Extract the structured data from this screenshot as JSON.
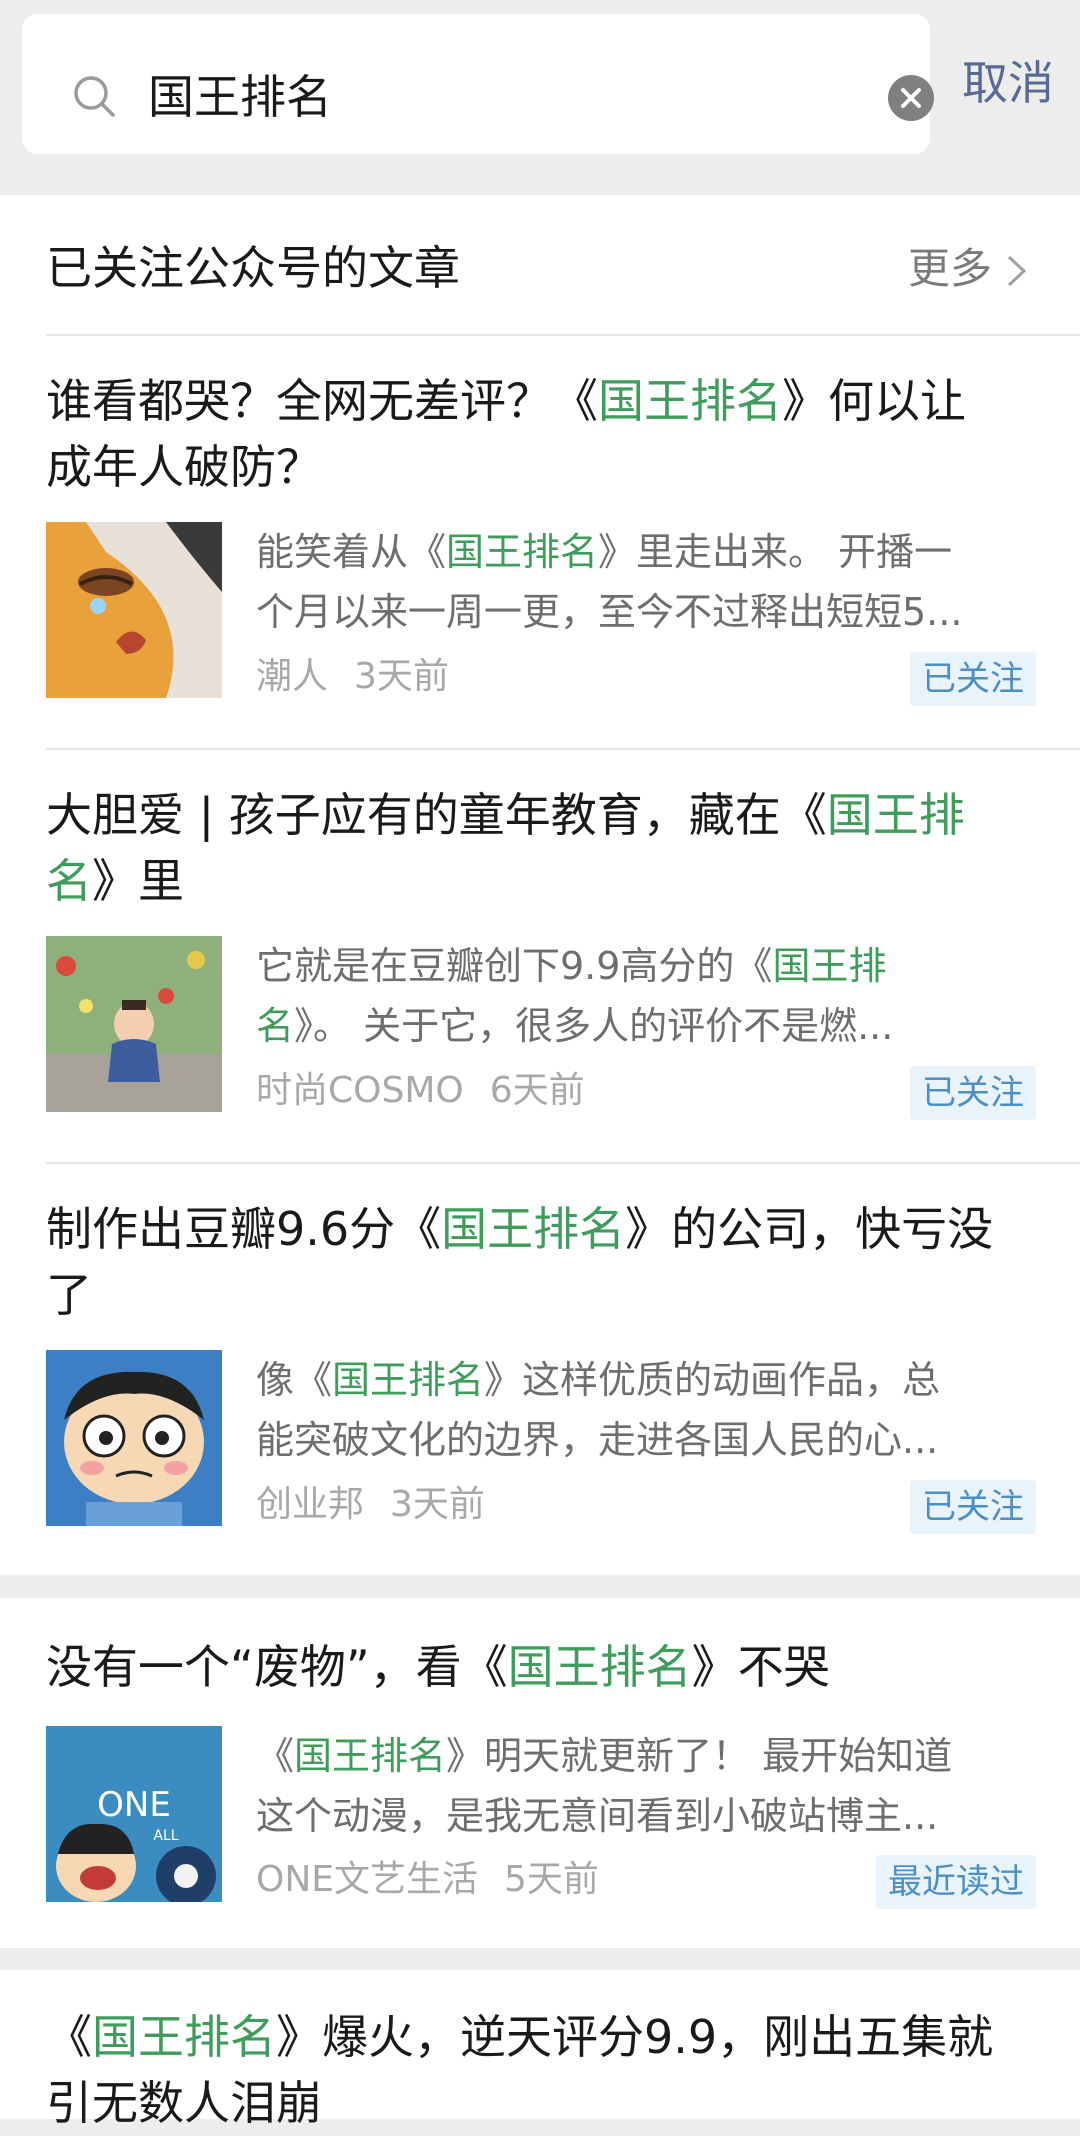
{
  "search": {
    "query": "国王排名",
    "cancel_label": "取消"
  },
  "section": {
    "title": "已关注公众号的文章",
    "more_label": "更多"
  },
  "articles": [
    {
      "title_parts": [
        "谁看都哭？全网无差评？《",
        "国王排名",
        "》何以让\n成年人破防？"
      ],
      "summary_parts": [
        "能笑着从《",
        "国王排名",
        "》里走出来。 开播一\n个月以来一周一更，至今不过释出短短5..."
      ],
      "source": "潮人",
      "time": "3天前",
      "badge": "已关注"
    },
    {
      "title_parts": [
        "大胆爱 | 孩子应有的童年教育，藏在《",
        "国王排\n名",
        "》里"
      ],
      "summary_parts": [
        "它就是在豆瓣创下9.9高分的《",
        "国王排\n名",
        "》。 关于它，很多人的评价不是燃..."
      ],
      "source": "时尚COSMO",
      "time": "6天前",
      "badge": "已关注"
    },
    {
      "title_parts": [
        "制作出豆瓣9.6分《",
        "国王排名",
        "》的公司，快亏没\n了"
      ],
      "summary_parts": [
        "像《",
        "国王排名",
        "》这样优质的动画作品，总\n能突破文化的边界，走进各国人民的心..."
      ],
      "source": "创业邦",
      "time": "3天前",
      "badge": "已关注"
    },
    {
      "title_parts": [
        "没有一个“废物”，看《",
        "国王排名",
        "》不哭"
      ],
      "summary_parts": [
        "《",
        "国王排名",
        "》明天就更新了！ 最开始知道\n这个动漫，是我无意间看到小破站博主..."
      ],
      "source": "ONE文艺生活",
      "time": "5天前",
      "badge": "最近读过",
      "thumb_text": "ONE",
      "thumb_subtext": "ALL"
    },
    {
      "title_parts": [
        "《",
        "国王排名",
        "》爆火，逆天评分9.9，刚出五集就\n引无数人泪崩"
      ]
    }
  ],
  "colors": {
    "highlight": "#3f9d5b",
    "link": "#576b95",
    "badge_text": "#4b8fc8",
    "badge_bg": "#e8f3fb",
    "page_bg": "#ededed"
  },
  "icons": {
    "search": "search-icon",
    "clear": "clear-icon",
    "more": "chevron-right-icon"
  }
}
